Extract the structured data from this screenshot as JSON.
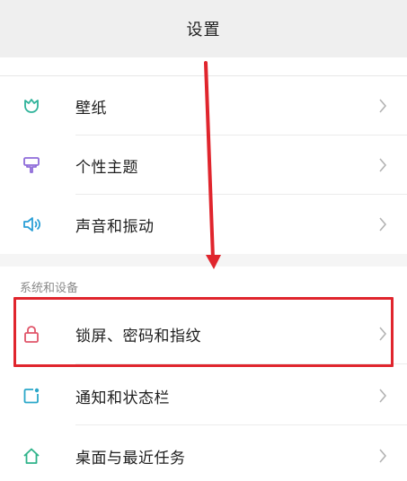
{
  "header": {
    "title": "设置"
  },
  "personalization": {
    "items": [
      {
        "label": "壁纸",
        "icon": "tulip-icon",
        "icon_color": "#2fb39a"
      },
      {
        "label": "个性主题",
        "icon": "brush-icon",
        "icon_color": "#8e6bd9"
      },
      {
        "label": "声音和振动",
        "icon": "speaker-icon",
        "icon_color": "#2a9fd6"
      }
    ]
  },
  "system": {
    "section_label": "系统和设备",
    "items": [
      {
        "label": "锁屏、密码和指纹",
        "icon": "lock-icon",
        "icon_color": "#e0566a"
      },
      {
        "label": "通知和状态栏",
        "icon": "notification-icon",
        "icon_color": "#2aa7c9"
      },
      {
        "label": "桌面与最近任务",
        "icon": "home-icon",
        "icon_color": "#2fb38a"
      }
    ]
  },
  "annotation": {
    "color": "#e0252d"
  }
}
